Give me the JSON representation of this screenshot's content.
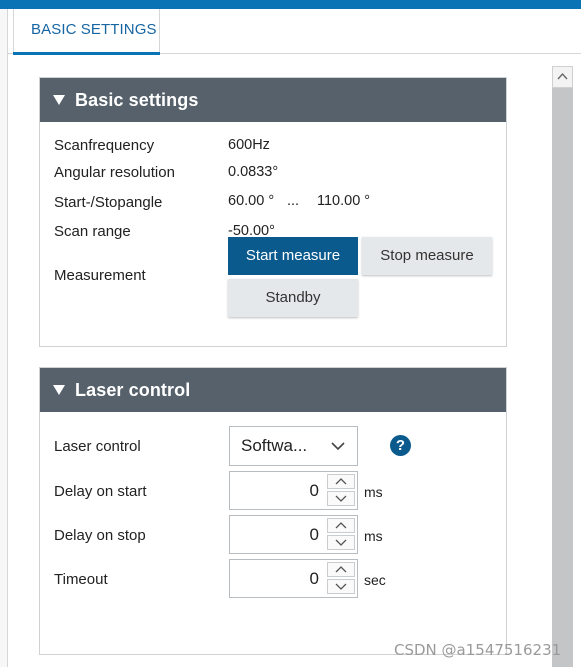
{
  "tab": {
    "label": "BASIC SETTINGS"
  },
  "basic": {
    "title": "Basic settings",
    "scanfrequency": {
      "label": "Scanfrequency",
      "value": "600Hz"
    },
    "angular": {
      "label": "Angular resolution",
      "value": "0.0833°"
    },
    "startstop": {
      "label": "Start-/Stopangle",
      "start": "60.00 °",
      "sep": "...",
      "stop": "110.00 °"
    },
    "scanrange": {
      "label": "Scan range",
      "value": "-50.00°"
    },
    "measurement": {
      "label": "Measurement",
      "start_button": "Start measure",
      "stop_button": "Stop measure",
      "standby_button": "Standby"
    }
  },
  "laser": {
    "title": "Laser control",
    "control": {
      "label": "Laser control",
      "selected": "Softwa..."
    },
    "delay_start": {
      "label": "Delay on start",
      "value": "0",
      "unit": "ms"
    },
    "delay_stop": {
      "label": "Delay on stop",
      "value": "0",
      "unit": "ms"
    },
    "timeout": {
      "label": "Timeout",
      "value": "0",
      "unit": "sec"
    },
    "help_glyph": "?"
  },
  "watermark": "CSDN @a1547516231",
  "colors": {
    "accent": "#0a73b6",
    "header": "#56616b",
    "primary_button": "#0b5a8e"
  },
  "icons": [
    "collapse-triangle-icon",
    "chevron-down-icon",
    "help-icon",
    "spin-up-icon",
    "spin-down-icon",
    "scroll-up-icon"
  ]
}
